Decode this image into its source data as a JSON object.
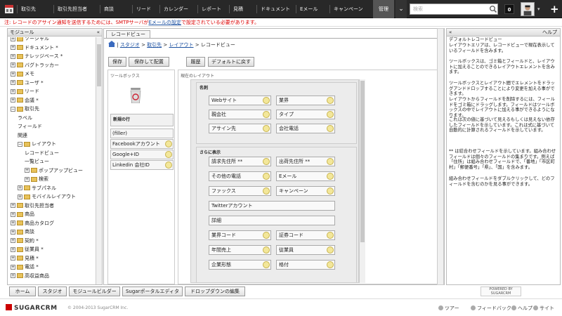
{
  "nav": {
    "items": [
      "取引先",
      "取引先担当者",
      "商談",
      "リード",
      "カレンダー",
      "レポート",
      "見積",
      "ドキュメント",
      "Eメール",
      "キャンペーン"
    ],
    "admin_tab": "管理",
    "search_placeholder": "検索",
    "notification_count": "0"
  },
  "alert": {
    "text_before": "注: レコードのアサイン通知を送信するためには、SMTPサーバがEメールの設定で設定されている必要があります。",
    "text_prefix": "注: レコードのアサイン通知を送信するためには、SMTPサーバが",
    "link": "Eメールの設定",
    "text_suffix": "で設定されている必要があります。"
  },
  "module_panel": {
    "title": "モジュール",
    "tree": [
      {
        "label": "ソーシャル",
        "exp": "+",
        "folder": true,
        "indent": 0
      },
      {
        "label": "ドキュメント *",
        "exp": "+",
        "folder": true,
        "indent": 0
      },
      {
        "label": "ナレッジベース *",
        "exp": "+",
        "folder": true,
        "indent": 0
      },
      {
        "label": "バグトラッカー",
        "exp": "+",
        "folder": true,
        "indent": 0
      },
      {
        "label": "メモ",
        "exp": "+",
        "folder": true,
        "indent": 0
      },
      {
        "label": "ユーザ *",
        "exp": "+",
        "folder": true,
        "indent": 0
      },
      {
        "label": "リード",
        "exp": "+",
        "folder": true,
        "indent": 0
      },
      {
        "label": "会議 *",
        "exp": "+",
        "folder": true,
        "indent": 0
      },
      {
        "label": "取引先",
        "exp": "−",
        "folder": true,
        "indent": 0
      },
      {
        "label": "ラベル",
        "exp": "",
        "folder": false,
        "indent": 1
      },
      {
        "label": "フィールド",
        "exp": "",
        "folder": false,
        "indent": 1
      },
      {
        "label": "関連",
        "exp": "",
        "folder": false,
        "indent": 1
      },
      {
        "label": "レイアウト",
        "exp": "−",
        "folder": true,
        "indent": 1
      },
      {
        "label": "レコードビュー",
        "exp": "",
        "folder": false,
        "indent": 2
      },
      {
        "label": "一覧ビュー",
        "exp": "",
        "folder": false,
        "indent": 2
      },
      {
        "label": "ポップアップビュー",
        "exp": "+",
        "folder": true,
        "indent": 2
      },
      {
        "label": "検索",
        "exp": "+",
        "folder": true,
        "indent": 2
      },
      {
        "label": "サブパネル",
        "exp": "+",
        "folder": true,
        "indent": 1
      },
      {
        "label": "モバイルレイアウト",
        "exp": "+",
        "folder": true,
        "indent": 1
      },
      {
        "label": "取引先担当者",
        "exp": "+",
        "folder": true,
        "indent": 0
      },
      {
        "label": "商品",
        "exp": "+",
        "folder": true,
        "indent": 0
      },
      {
        "label": "商品カタログ",
        "exp": "+",
        "folder": true,
        "indent": 0
      },
      {
        "label": "商談",
        "exp": "+",
        "folder": true,
        "indent": 0
      },
      {
        "label": "契約 *",
        "exp": "+",
        "folder": true,
        "indent": 0
      },
      {
        "label": "従業員 *",
        "exp": "+",
        "folder": true,
        "indent": 0
      },
      {
        "label": "見積 *",
        "exp": "+",
        "folder": true,
        "indent": 0
      },
      {
        "label": "電話 *",
        "exp": "+",
        "folder": true,
        "indent": 0
      },
      {
        "label": "高収益商品",
        "exp": "+",
        "folder": true,
        "indent": 0
      }
    ]
  },
  "center": {
    "tab": "レコードビュー",
    "breadcrumb": {
      "studio": "スタジオ",
      "module": "取引先",
      "layout": "レイアウト",
      "current": "レコードビュー",
      "sep": ">"
    },
    "buttons": {
      "save": "保存",
      "save_deploy": "保存して配置",
      "history": "履歴",
      "restore": "デフォルトに戻す"
    },
    "toolbox": {
      "title": "ツールボックス",
      "new_row": "新規の行",
      "fields": [
        "(filler)",
        "Facebookアカウント",
        "Google+ID",
        "Linkedin 会社ID"
      ]
    },
    "layout": {
      "label": "現在のレイアウト",
      "panels": [
        {
          "title": "名刺",
          "rows": [
            [
              "Webサイト",
              "業界"
            ],
            [
              "親会社",
              "タイプ"
            ],
            [
              "アサイン先",
              "会社電話"
            ]
          ]
        },
        {
          "title": "さらに表示",
          "rows": [
            [
              "請求先住所 **",
              "出荷先住所 **"
            ],
            [
              "その他の電話",
              "Eメール"
            ],
            [
              "ファックス",
              "キャンペーン"
            ],
            [
              "Twitterアカウント"
            ],
            [
              "詳細"
            ],
            [
              "業界コード",
              "証券コード"
            ],
            [
              "年間売上",
              "従業員"
            ],
            [
              "企業形態",
              "格付"
            ]
          ]
        }
      ]
    }
  },
  "help": {
    "title": "ヘルプ",
    "arrow": "«",
    "paragraphs": [
      "デフォルトレコードビュー",
      "レイアウトエリアは、レコードビューで現在表示しているフィールドを含みます。",
      "ツールボックスは、ゴミ箱とフィールドと、レイアウトに加えることのできるレイアウトエレメントを含みます。",
      "ツールボックスとレイアウト間でエレメントをドラッグアンドドロップすることにより変更を加える事ができます。",
      "レイアウトからフィールドを削除するには、フィールドをゴミ箱にドラッグします。フィールドはツールボックスの中でレイアウトに加える事ができるようになります。",
      "これは次の値に基づいて見えるもしくは見えない依存したフィールドを示しています。これは式に基づいて自動的に計算されるフィールドを示しています。",
      "** は結合わせフィールドを示しています。組み合わせフィールドは個々のフィールドの集まりです。例えば「住所」は組み合わせフィールドで、「番地」「市区町村」「郵便番号」「県」、「国」を含みます。",
      "組み合わせフィールドをダブルクリックして、どのフィールドを含むのかを見る事ができます。"
    ]
  },
  "bottom_tabs": [
    "ホーム",
    "スタジオ",
    "モジュールビルダー",
    "Sugarポータルエディタ",
    "ドロップダウンの編集"
  ],
  "powered_by": "POWERED BY SUGARCRM",
  "footer": {
    "logo": "SUGARCRM",
    "copyright": "© 2004-2013 SugarCRM Inc.",
    "links": [
      "ツアー",
      "フィードバック",
      "ヘルプ",
      "サイト"
    ]
  },
  "colors": {
    "nav_bg": "#282828",
    "alert_red": "#dd0000",
    "link_blue": "#1a4fa0",
    "brand_red": "#cc0000"
  }
}
